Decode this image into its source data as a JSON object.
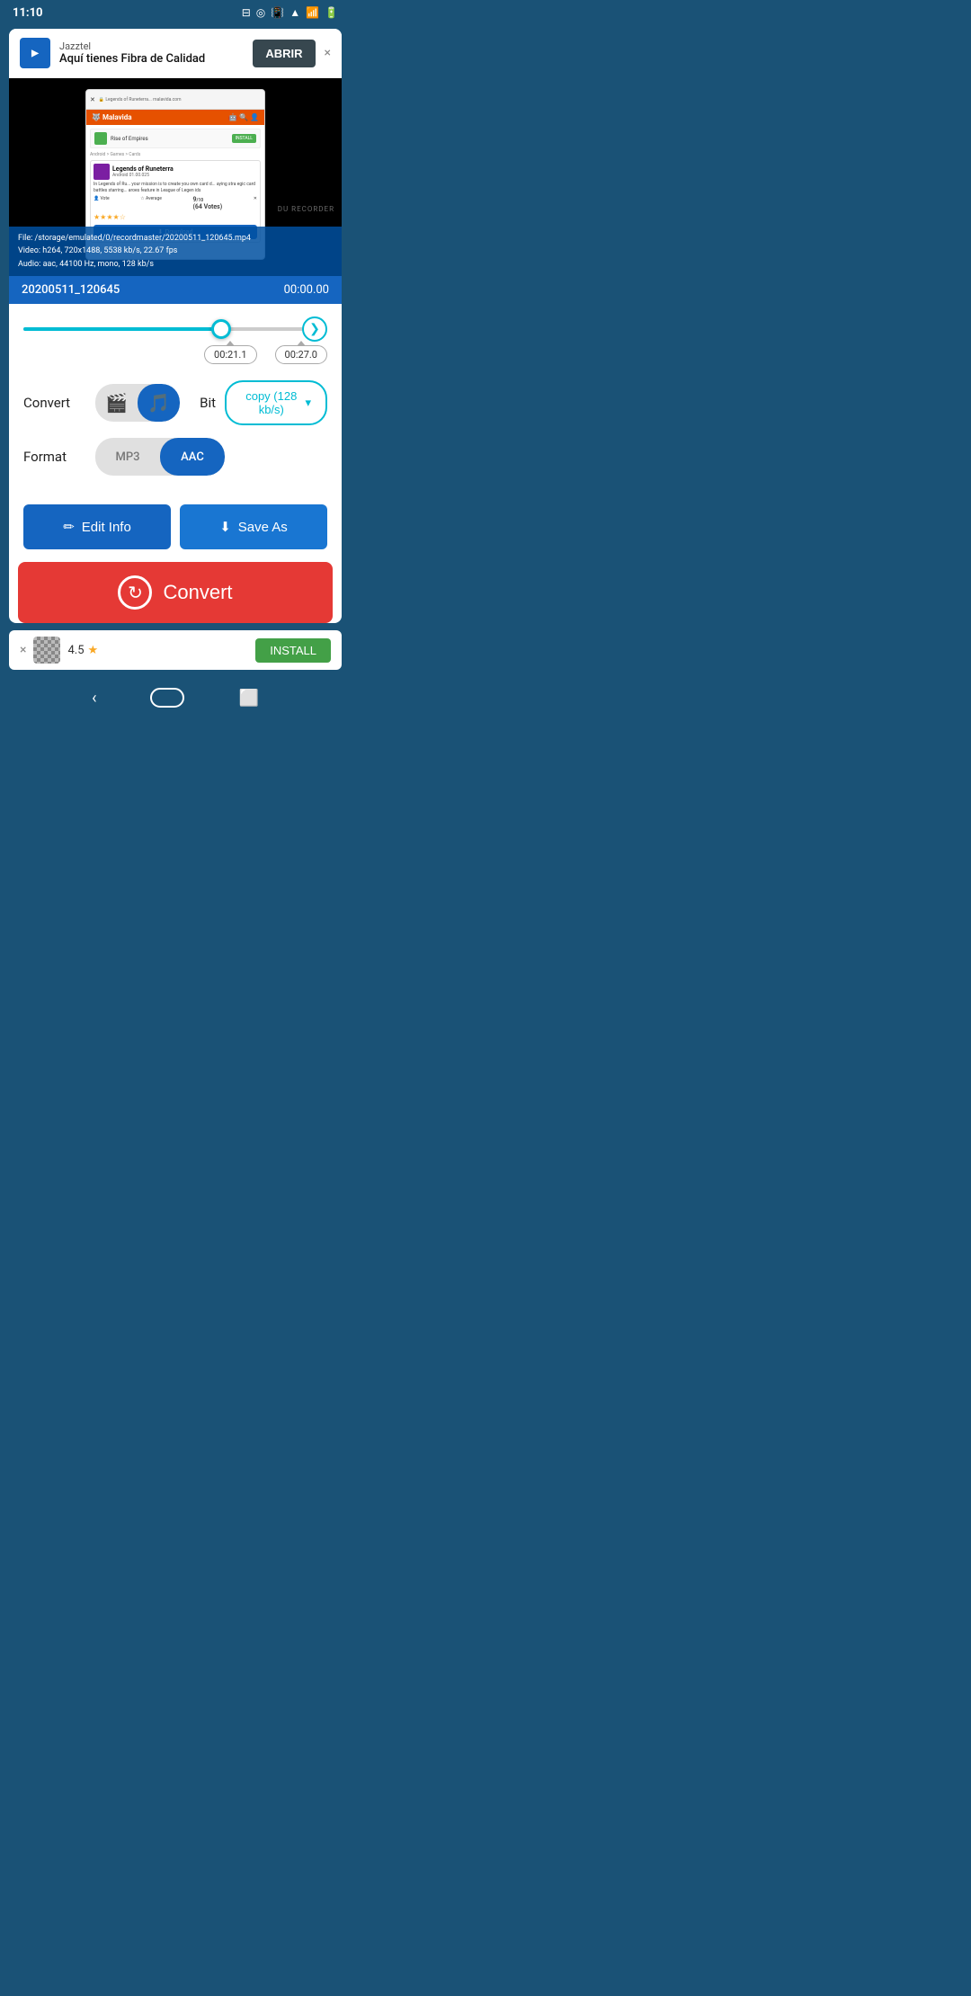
{
  "statusBar": {
    "time": "11:10",
    "icons": [
      "vibrate",
      "wifi",
      "signal",
      "battery"
    ]
  },
  "ad": {
    "brand": "Jazztel",
    "title": "Aquí tienes Fibra de Calidad",
    "button": "ABRIR",
    "closeIcon": "×"
  },
  "video": {
    "fileInfo": "File: /storage/emulated/0/recordmaster/20200511_120645.mp4",
    "videoInfo": "Video: h264,  720x1488,  5538 kb/s,  22.67 fps",
    "audioInfo": "Audio: aac,  44100 Hz,  mono, 128 kb/s",
    "watermark": "DU RECORDER",
    "filename": "20200511_120645",
    "duration": "00:00.00"
  },
  "slider": {
    "startTime": "00:21.1",
    "endTime": "00:27.0",
    "arrowIcon": "❯"
  },
  "controls": {
    "convertLabel": "Convert",
    "videoIcon": "🎬",
    "musicIcon": "🎵",
    "bitLabel": "Bit",
    "bitValue": "copy (128 kb/s)",
    "bitDropdown": "▾",
    "formatLabel": "Format",
    "formatMP3": "MP3",
    "formatAAC": "AAC",
    "activeToggle": "music",
    "activeFormat": "AAC"
  },
  "actions": {
    "editIcon": "✏",
    "editLabel": "Edit Info",
    "saveIcon": "⬇",
    "saveLabel": "Save As"
  },
  "convertBtn": {
    "label": "Convert",
    "icon": "↻"
  },
  "bottomAd": {
    "closeIcon": "×",
    "rating": "4.5",
    "starIcon": "★",
    "installLabel": "INSTALL"
  },
  "colors": {
    "primary": "#1565c0",
    "accent": "#00bcd4",
    "convert": "#e53935",
    "bg": "#1a5276"
  }
}
